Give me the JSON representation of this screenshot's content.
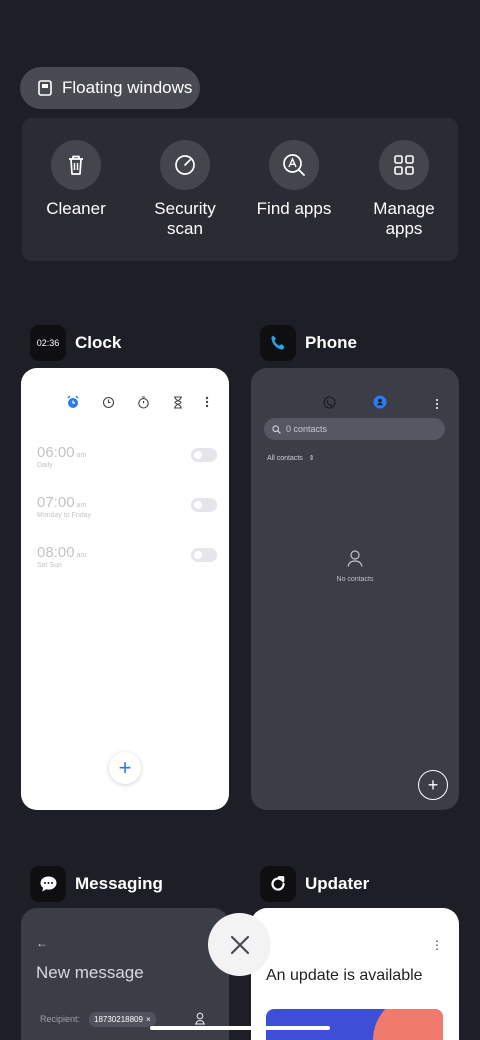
{
  "floating_windows": {
    "label": "Floating windows",
    "icon": "floating-window-icon"
  },
  "quick_actions": [
    {
      "label": "Cleaner",
      "icon": "trash-icon"
    },
    {
      "label": "Security scan",
      "icon": "security-scan-icon"
    },
    {
      "label": "Find apps",
      "icon": "find-apps-icon"
    },
    {
      "label": "Manage apps",
      "icon": "grid-icon"
    }
  ],
  "apps": {
    "clock": {
      "name": "Clock",
      "icon_text": "02:36",
      "alarms": [
        {
          "time": "06:00",
          "ampm": "am",
          "repeat": "Daily"
        },
        {
          "time": "07:00",
          "ampm": "am",
          "repeat": "Monday to Friday"
        },
        {
          "time": "08:00",
          "ampm": "am",
          "repeat": "Sat Sun"
        }
      ]
    },
    "phone": {
      "name": "Phone",
      "icon": "phone-icon",
      "search_placeholder": "0 contacts",
      "filter_label": "All contacts",
      "empty_text": "No contacts"
    },
    "messaging": {
      "name": "Messaging",
      "icon": "message-icon",
      "title": "New message",
      "recipient_label": "Recipient:",
      "recipient_value": "18730218809",
      "chip_close": "×"
    },
    "updater": {
      "name": "Updater",
      "icon": "refresh-icon",
      "headline": "An update is available"
    }
  },
  "colors": {
    "background": "#1e1f26",
    "panel": "#2a2b33",
    "accent_blue": "#2a7bf0",
    "phone_blue": "#2aa3e0"
  }
}
